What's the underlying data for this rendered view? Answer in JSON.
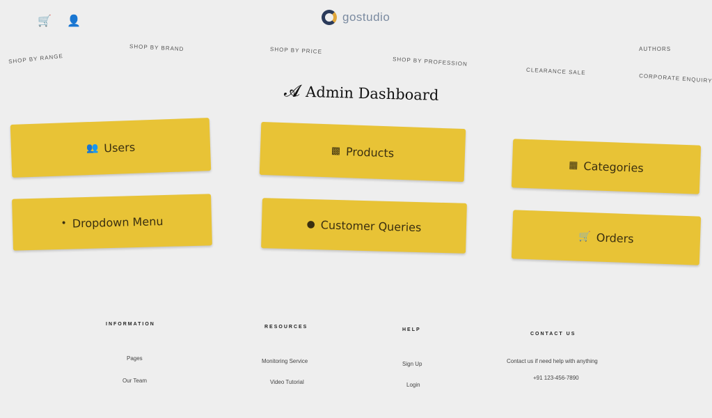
{
  "header": {
    "icons": [
      "cart-icon",
      "user-icon"
    ],
    "logo_text": "gostudio"
  },
  "nav": [
    "SHOP BY RANGE",
    "SHOP BY BRAND",
    "SHOP BY PRICE",
    "SHOP BY PROFESSION",
    "CLEARANCE SALE",
    "CORPORATE ENQUIRY",
    "AUTHORS"
  ],
  "page": {
    "title": "Admin Dashboard",
    "title_icon": "user-tie-icon"
  },
  "cards": [
    {
      "label": "Users",
      "icon": "users-icon"
    },
    {
      "label": "Products",
      "icon": "boxes-icon"
    },
    {
      "label": "Categories",
      "icon": "grid-icon"
    },
    {
      "label": "Dropdown Menu",
      "icon": "dot-icon"
    },
    {
      "label": "Customer Queries",
      "icon": "chat-icon"
    },
    {
      "label": "Orders",
      "icon": "cart-icon"
    }
  ],
  "footer": {
    "columns": [
      {
        "heading": "INFORMATION",
        "links": [
          "Pages",
          "Our Team"
        ]
      },
      {
        "heading": "RESOURCES",
        "links": [
          "Monitoring Service",
          "Video Tutorial"
        ]
      },
      {
        "heading": "HELP",
        "links": [
          "Sign Up",
          "Login"
        ]
      },
      {
        "heading": "CONTACT US",
        "links": [
          "Contact us if need help with anything",
          "+91 123-456-7890"
        ]
      }
    ]
  },
  "colors": {
    "card_bg": "#e8c336",
    "page_bg": "#eeeeee"
  }
}
